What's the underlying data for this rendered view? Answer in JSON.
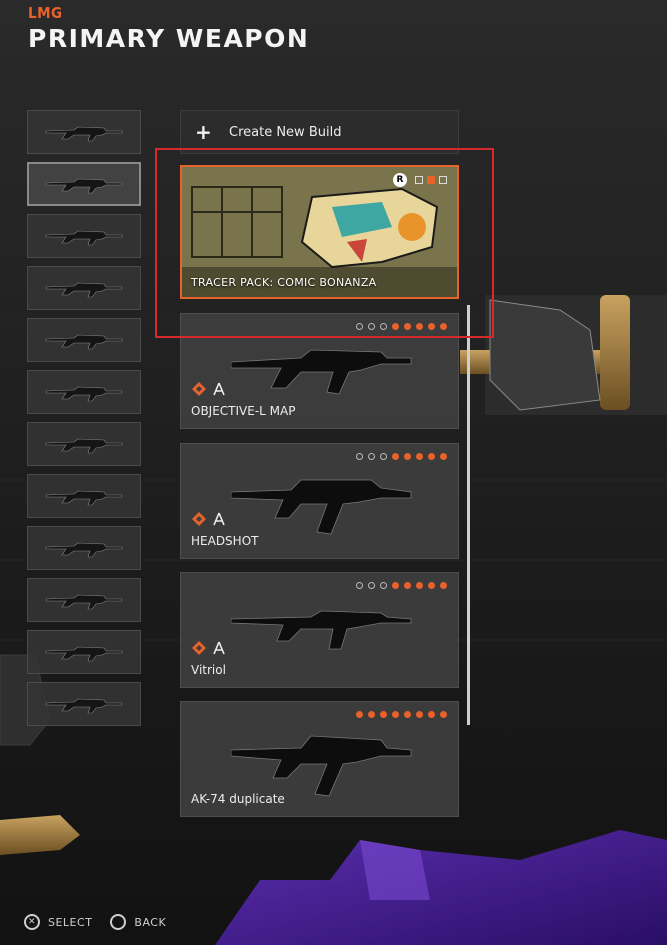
{
  "header": {
    "category": "LMG",
    "title": "PRIMARY WEAPON"
  },
  "thumbnails": [
    {
      "icon": "weapon-thumb-icon"
    },
    {
      "icon": "weapon-thumb-icon",
      "selected": true
    },
    {
      "icon": "weapon-thumb-icon"
    },
    {
      "icon": "weapon-thumb-icon"
    },
    {
      "icon": "weapon-thumb-icon"
    },
    {
      "icon": "weapon-thumb-icon"
    },
    {
      "icon": "weapon-thumb-icon"
    },
    {
      "icon": "weapon-thumb-icon"
    },
    {
      "icon": "weapon-thumb-icon"
    },
    {
      "icon": "weapon-thumb-icon"
    },
    {
      "icon": "weapon-thumb-icon"
    },
    {
      "icon": "weapon-thumb-icon"
    }
  ],
  "create_build": {
    "icon": "plus-icon",
    "label": "Create New Build"
  },
  "tracer_pack": {
    "label": "TRACER PACK: COMIC BONANZA",
    "badge": "R"
  },
  "builds": [
    {
      "name": "OBJECTIVE-L MAP",
      "attachments_empty": 3,
      "attachments_filled": 5
    },
    {
      "name": "HEADSHOT",
      "attachments_empty": 3,
      "attachments_filled": 5
    },
    {
      "name": "Vitriol",
      "attachments_empty": 3,
      "attachments_filled": 5
    },
    {
      "name": "AK-74 duplicate",
      "attachments_empty": 0,
      "attachments_filled": 8
    }
  ],
  "footer": {
    "select": {
      "button": "✕",
      "label": "SELECT"
    },
    "back": {
      "button": "○",
      "label": "BACK"
    }
  },
  "colors": {
    "accent": "#e8622b",
    "highlight": "#d42a2a",
    "panel": "#3e3e3e"
  }
}
